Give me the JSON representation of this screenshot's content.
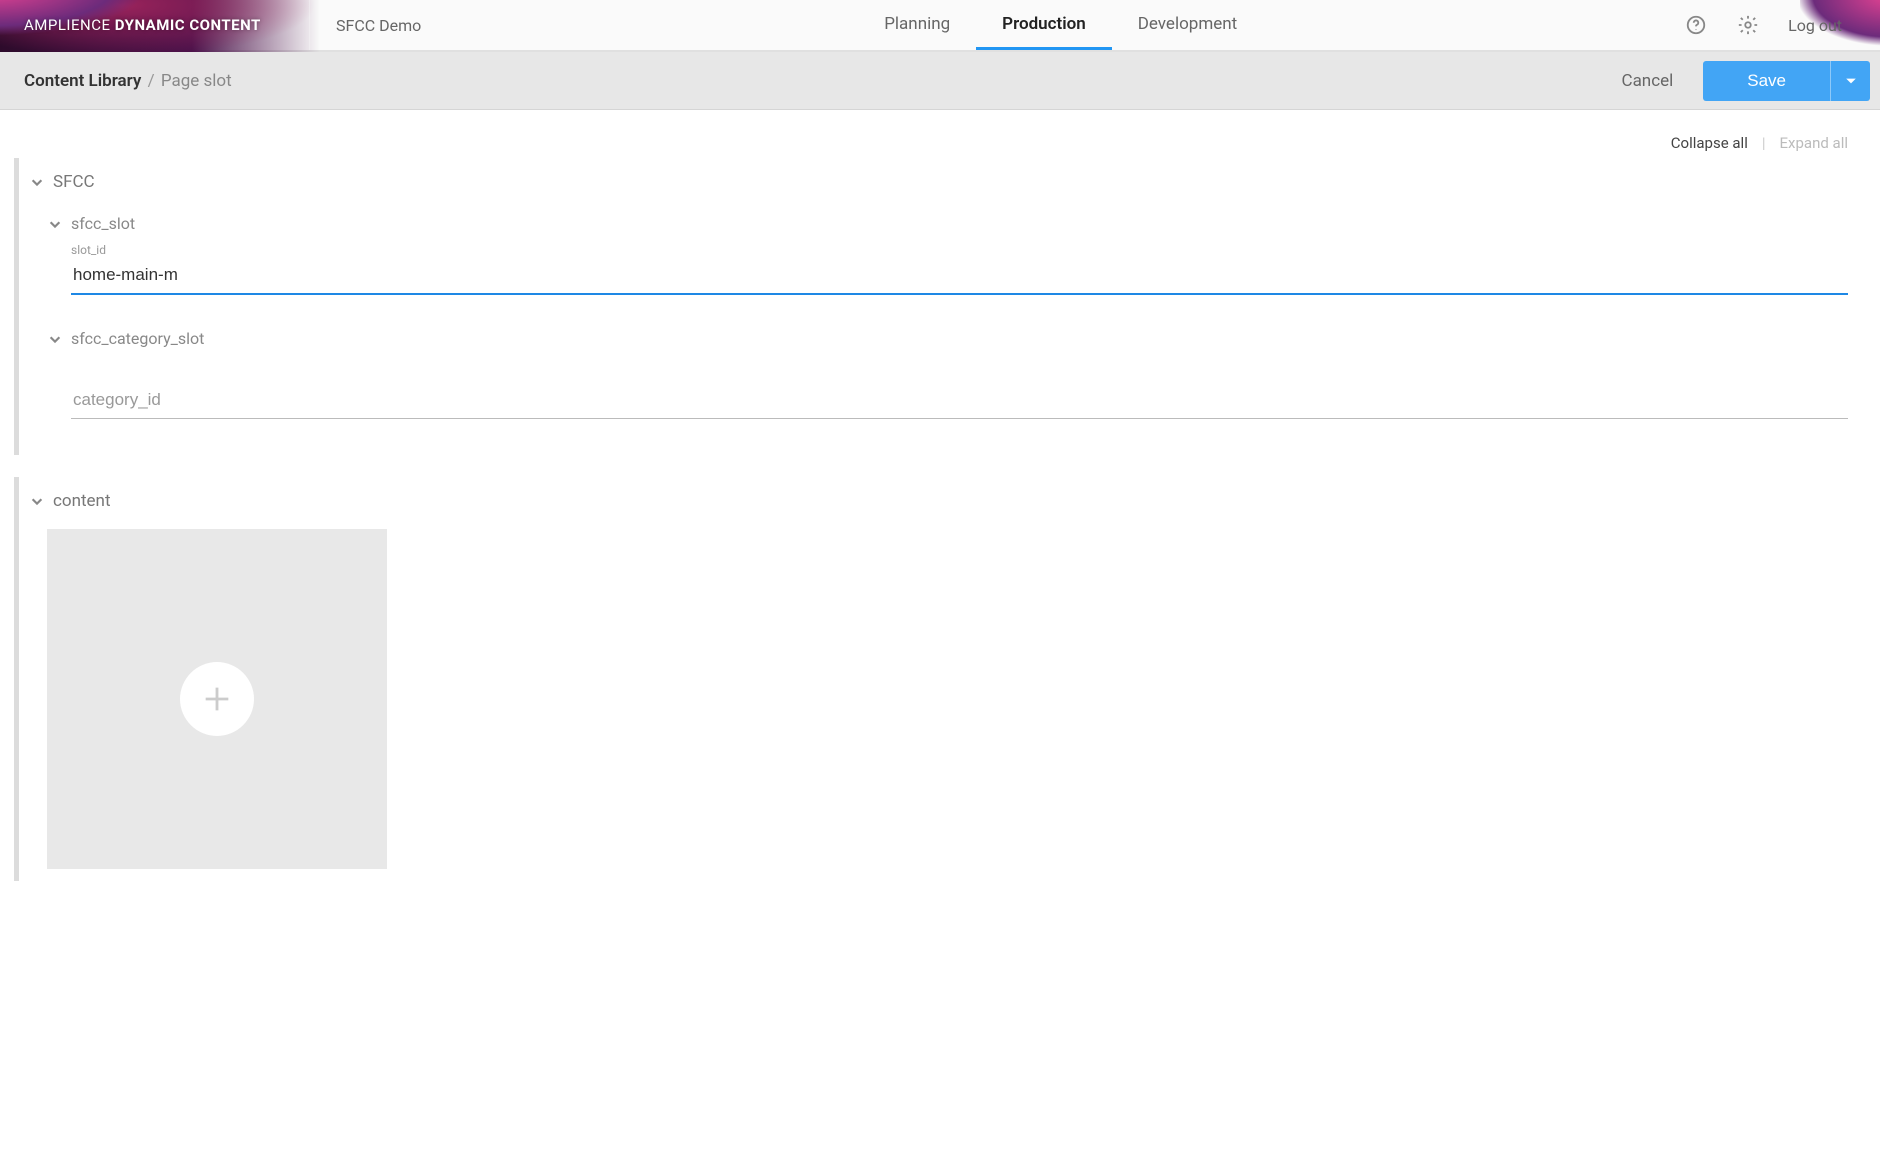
{
  "header": {
    "brand_prefix": "AMPLIENCE ",
    "brand_strong": "DYNAMIC CONTENT",
    "project": "SFCC Demo",
    "tabs": [
      {
        "label": "Planning",
        "active": false
      },
      {
        "label": "Production",
        "active": true
      },
      {
        "label": "Development",
        "active": false
      }
    ],
    "logout": "Log out"
  },
  "subbar": {
    "breadcrumb_root": "Content Library",
    "breadcrumb_sep": "/",
    "breadcrumb_leaf": "Page slot",
    "cancel": "Cancel",
    "save": "Save"
  },
  "toolbar": {
    "collapse": "Collapse all",
    "sep": "|",
    "expand": "Expand all"
  },
  "form": {
    "sfcc": {
      "title": "SFCC",
      "slot": {
        "title": "sfcc_slot",
        "field_label": "slot_id",
        "field_value": "home-main-m"
      },
      "category_slot": {
        "title": "sfcc_category_slot",
        "field_placeholder": "category_id"
      }
    },
    "content": {
      "title": "content"
    }
  }
}
